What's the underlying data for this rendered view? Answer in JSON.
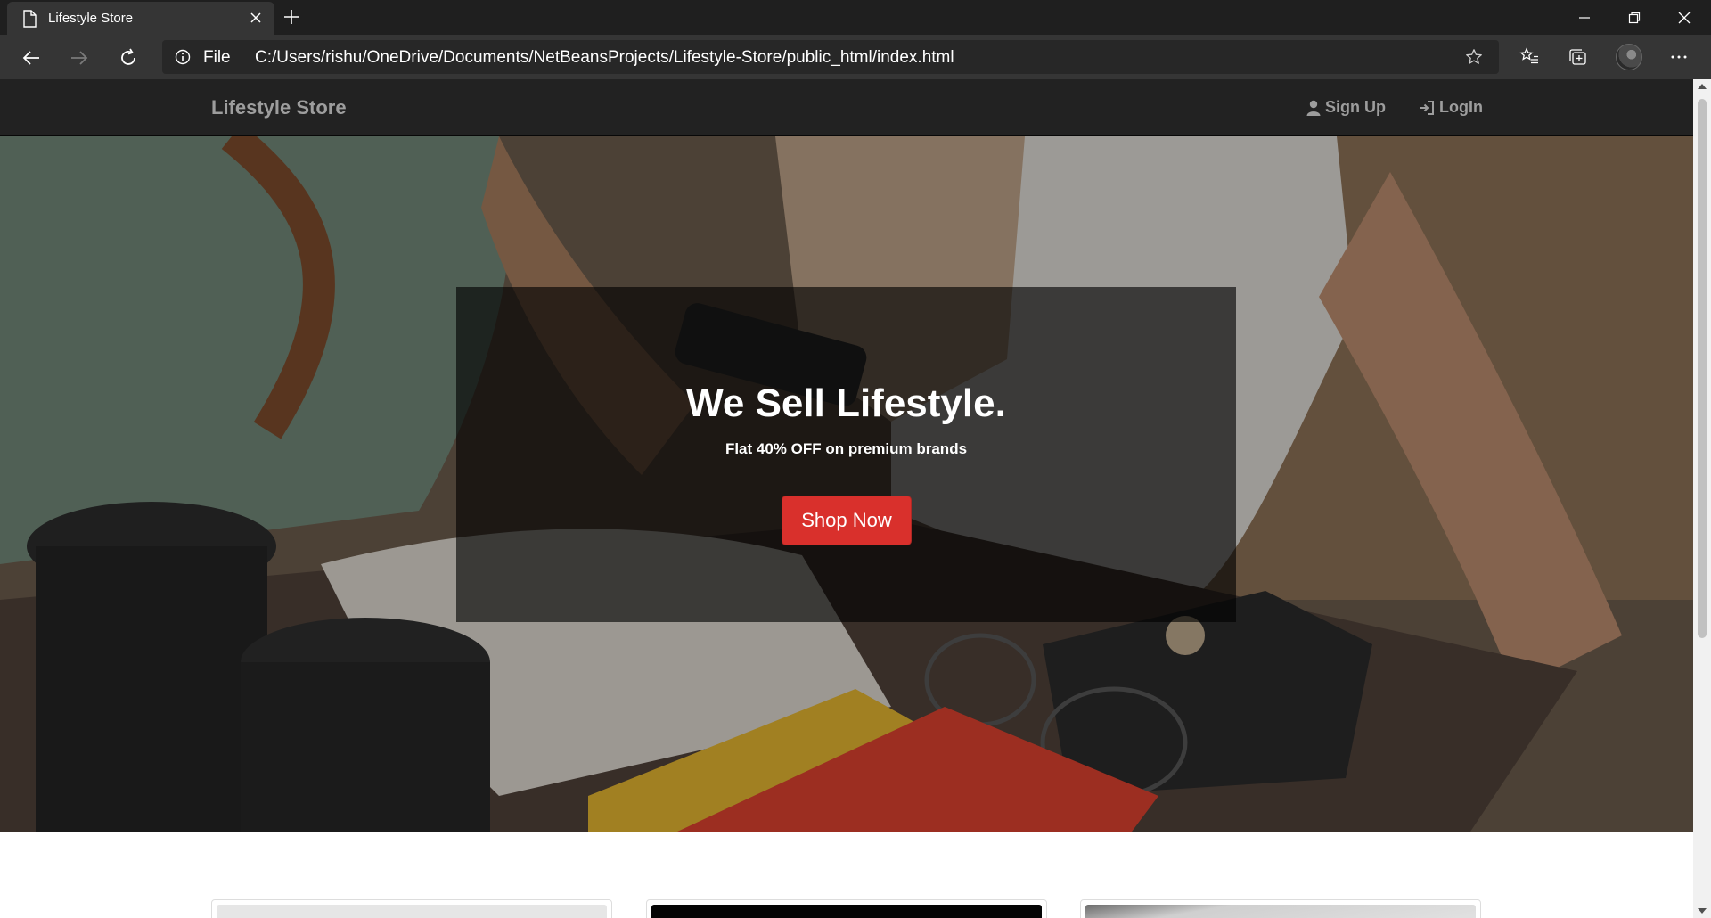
{
  "browser": {
    "tab_title": "Lifestyle Store",
    "address_scheme": "File",
    "address_url": "C:/Users/rishu/OneDrive/Documents/NetBeansProjects/Lifestyle-Store/public_html/index.html",
    "icons": [
      "document-icon",
      "close-icon",
      "plus-icon",
      "minimize-icon",
      "restore-icon",
      "window-close-icon",
      "back-icon",
      "forward-icon",
      "refresh-icon",
      "info-icon",
      "star-icon",
      "favorites-icon",
      "collections-icon",
      "profile-avatar",
      "more-icon"
    ]
  },
  "navbar": {
    "brand": "Lifestyle Store",
    "signup_label": "Sign Up",
    "login_label": "LogIn"
  },
  "hero": {
    "heading": "We Sell Lifestyle.",
    "subheading": "Flat 40% OFF on premium brands",
    "cta_label": "Shop Now"
  },
  "colors": {
    "navbar_bg": "#222222",
    "nav_text": "#9d9d9d",
    "cta_bg": "#d9302c",
    "banner_bg": "rgba(0,0,0,0.62)"
  }
}
